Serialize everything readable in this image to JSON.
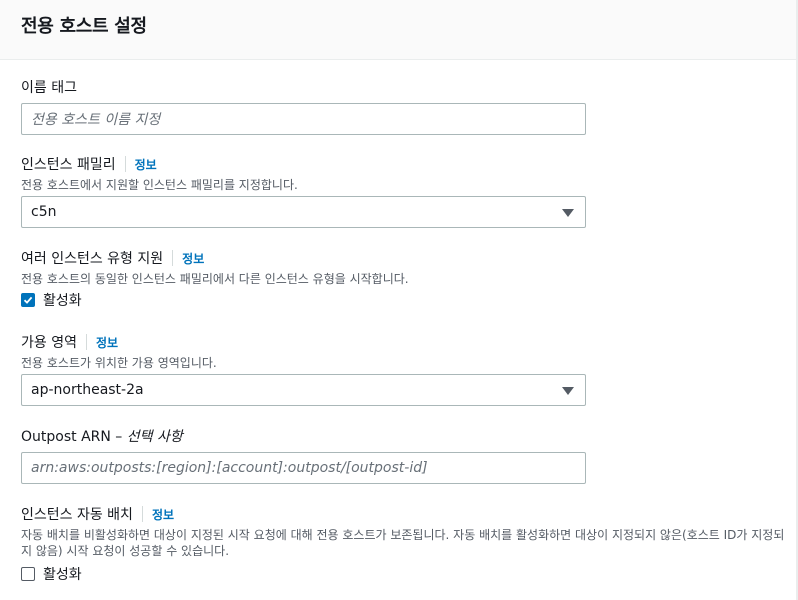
{
  "header": {
    "title": "전용 호스트 설정"
  },
  "name_tag": {
    "label": "이름 태그",
    "placeholder": "전용 호스트 이름 지정"
  },
  "instance_family": {
    "label": "인스턴스 패밀리",
    "info": "정보",
    "description": "전용 호스트에서 지원할 인스턴스 패밀리를 지정합니다.",
    "value": "c5n"
  },
  "multi_type": {
    "label": "여러 인스턴스 유형 지원",
    "info": "정보",
    "description": "전용 호스트의 동일한 인스턴스 패밀리에서 다른 인스턴스 유형을 시작합니다.",
    "checkbox_label": "활성화",
    "checked": true
  },
  "availability_zone": {
    "label": "가용 영역",
    "info": "정보",
    "description": "전용 호스트가 위치한 가용 영역입니다.",
    "value": "ap-northeast-2a"
  },
  "outpost_arn": {
    "label": "Outpost ARN –",
    "optional": "선택 사항",
    "placeholder": "arn:aws:outposts:[region]:[account]:outpost/[outpost-id]"
  },
  "auto_placement": {
    "label": "인스턴스 자동 배치",
    "info": "정보",
    "description": "자동 배치를 비활성화하면 대상이 지정된 시작 요청에 대해 전용 호스트가 보존됩니다. 자동 배치를 활성화하면 대상이 지정되지 않은(호스트 ID가 지정되지 않음) 시작 요청이 성공할 수 있습니다.",
    "checkbox_label": "활성화",
    "checked": false
  },
  "colors": {
    "accent": "#0073bb",
    "border": "#aab7b8",
    "text": "#16191f",
    "muted": "#545b64"
  }
}
